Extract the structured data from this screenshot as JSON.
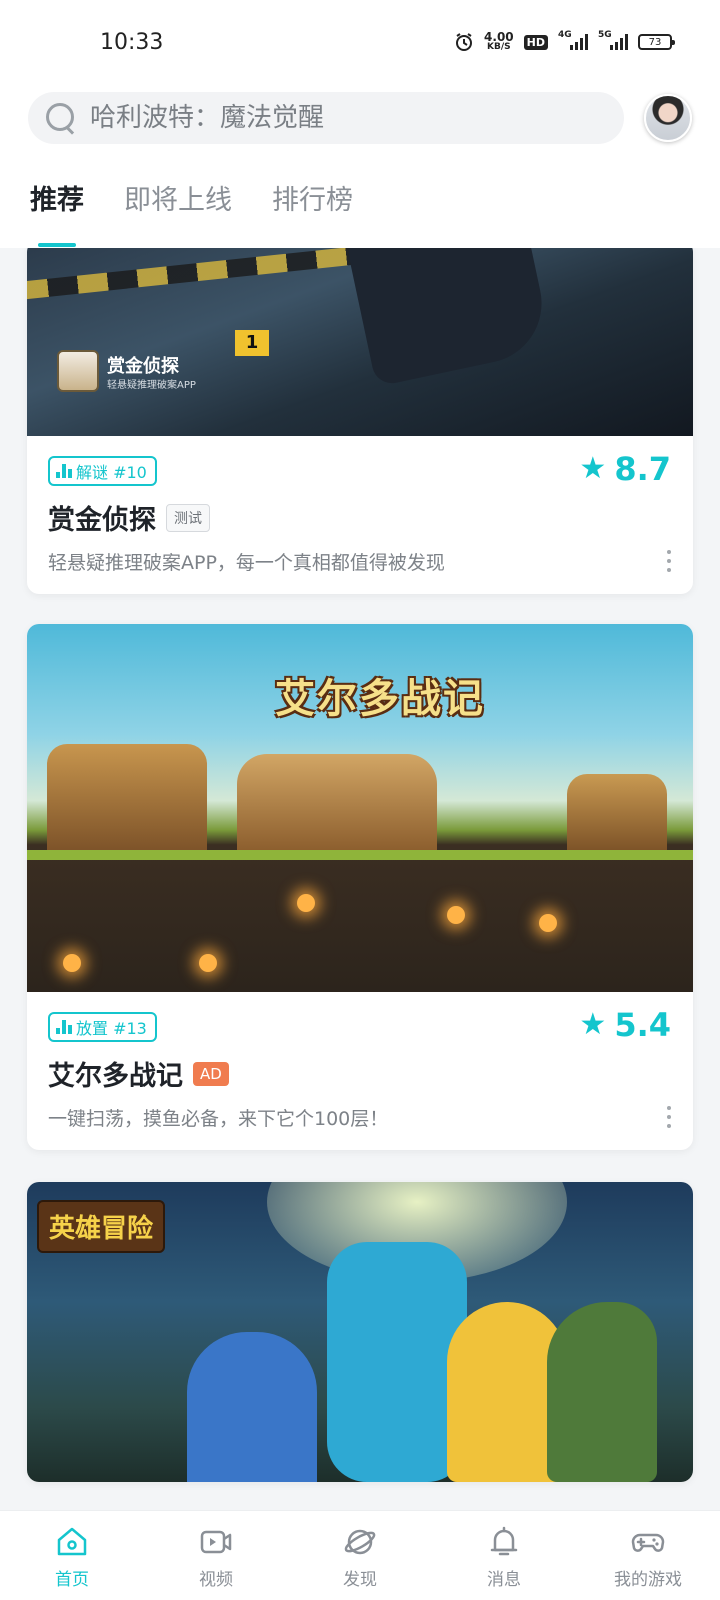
{
  "status_bar": {
    "time": "10:33",
    "net_speed_value": "4.00",
    "net_speed_unit": "KB/S",
    "hd_label": "HD",
    "signal1_label": "4G",
    "signal2_label": "5G",
    "battery": "73",
    "icons": [
      "alarm-icon",
      "hd-icon",
      "signal-4g-icon",
      "signal-5g-icon",
      "battery-icon"
    ]
  },
  "search": {
    "placeholder": "哈利波特：魔法觉醒"
  },
  "tabs": [
    {
      "label": "推荐",
      "active": true
    },
    {
      "label": "即将上线",
      "active": false
    },
    {
      "label": "排行榜",
      "active": false
    }
  ],
  "cards": [
    {
      "banner_title": "赏金侦探",
      "banner_subtitle": "轻悬疑推理破案APP",
      "banner_marker": "1",
      "category_tag": "解谜 #10",
      "rating": "8.7",
      "name": "赏金侦探",
      "badge": "测试",
      "description": "轻悬疑推理破案APP，每一个真相都值得被发现"
    },
    {
      "banner_title": "艾尔多战记",
      "category_tag": "放置 #13",
      "rating": "5.4",
      "name": "艾尔多战记",
      "badge": "AD",
      "description": "一键扫荡，摸鱼必备，来下它个100层！"
    },
    {
      "banner_title": "英雄冒险"
    }
  ],
  "bottom_nav": [
    {
      "label": "首页",
      "icon": "home-icon",
      "active": true
    },
    {
      "label": "视频",
      "icon": "video-icon",
      "active": false
    },
    {
      "label": "发现",
      "icon": "discover-icon",
      "active": false
    },
    {
      "label": "消息",
      "icon": "bell-icon",
      "active": false
    },
    {
      "label": "我的游戏",
      "icon": "gamepad-icon",
      "active": false
    }
  ],
  "colors": {
    "accent": "#14c5cd",
    "ad_badge": "#f07c4f"
  }
}
